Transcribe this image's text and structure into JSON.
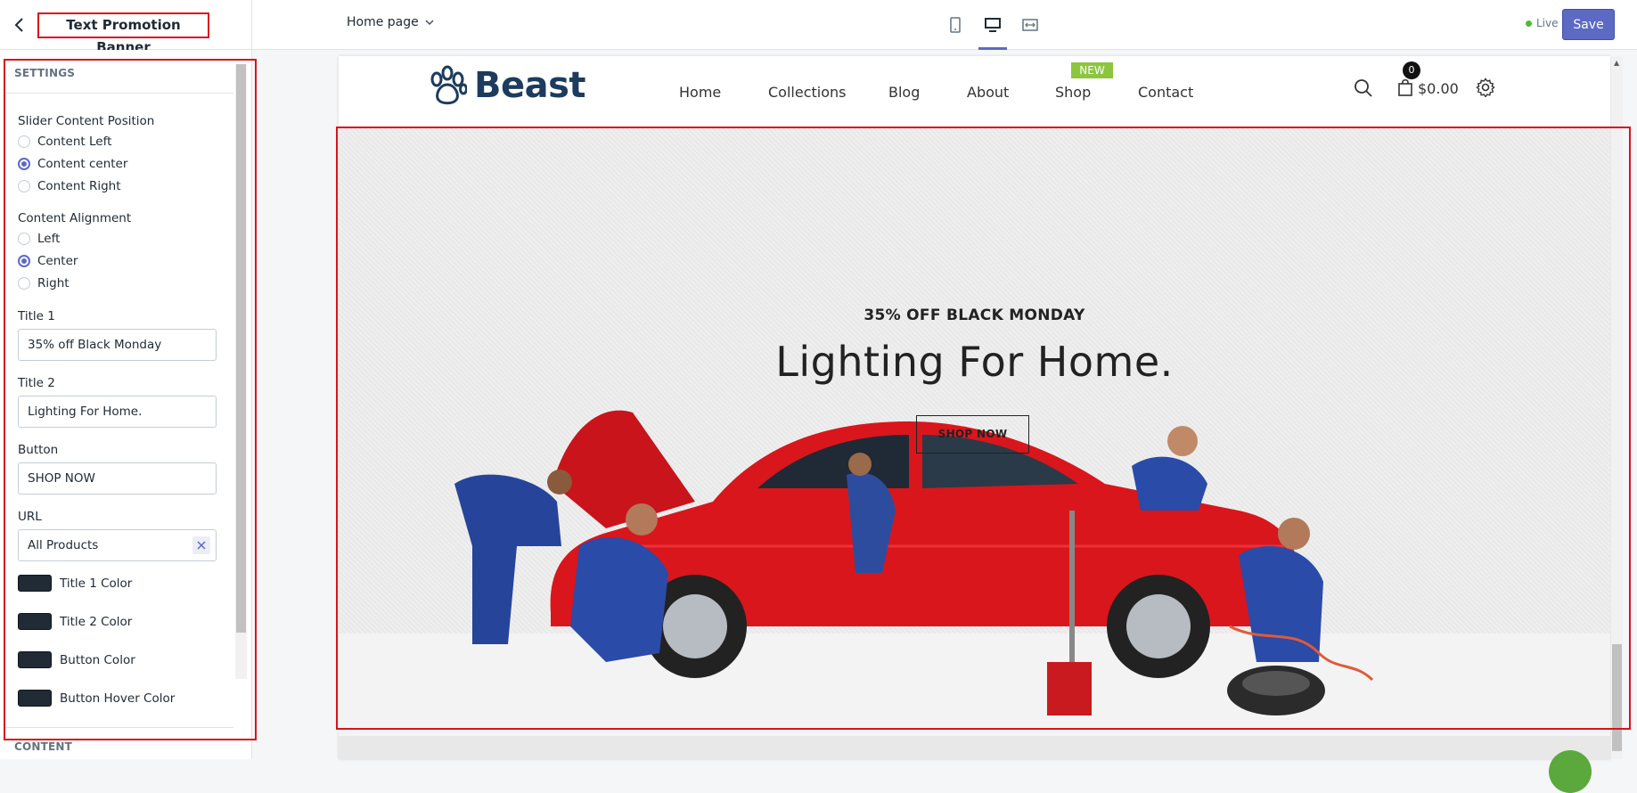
{
  "topbar": {
    "panel_title": "Text Promotion Banner",
    "page_selector": "Home page",
    "status": "Live",
    "save_label": "Save"
  },
  "sidebar": {
    "settings_heading": "SETTINGS",
    "content_heading": "CONTENT",
    "slider_position": {
      "label": "Slider Content Position",
      "options": [
        "Content Left",
        "Content center",
        "Content Right"
      ],
      "selected": "Content center"
    },
    "content_alignment": {
      "label": "Content Alignment",
      "options": [
        "Left",
        "Center",
        "Right"
      ],
      "selected": "Center"
    },
    "title1": {
      "label": "Title 1",
      "value": "35% off Black Monday"
    },
    "title2": {
      "label": "Title 2",
      "value": "Lighting For Home."
    },
    "button": {
      "label": "Button",
      "value": "SHOP NOW"
    },
    "url": {
      "label": "URL",
      "value": "All Products"
    },
    "colors": [
      {
        "label": "Title 1 Color",
        "value": "#212b36"
      },
      {
        "label": "Title 2 Color",
        "value": "#212b36"
      },
      {
        "label": "Button Color",
        "value": "#212b36"
      },
      {
        "label": "Button Hover Color",
        "value": "#212b36"
      }
    ]
  },
  "store": {
    "logo_text": "Beast",
    "nav": [
      "Home",
      "Collections",
      "Blog",
      "About",
      "Shop",
      "Contact"
    ],
    "new_badge": "NEW",
    "cart_count": "0",
    "cart_total": "$0.00"
  },
  "banner": {
    "subtitle": "35% OFF BLACK MONDAY",
    "title": "Lighting For Home.",
    "button": "SHOP NOW"
  },
  "colors": {
    "accent": "#5c6ac4",
    "highlight_frame": "#d9141b",
    "new_badge": "#8cc63f",
    "live_dot": "#50b83c",
    "logo": "#1c3b5e"
  }
}
